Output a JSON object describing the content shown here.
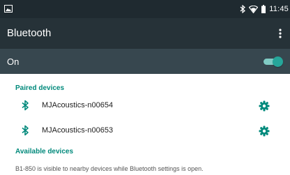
{
  "status_bar": {
    "time": "11:45",
    "left_icon": "image-notification-icon",
    "right_icons": [
      "bluetooth-icon",
      "wifi-icon",
      "battery-icon"
    ]
  },
  "app_bar": {
    "title": "Bluetooth",
    "menu_icon": "overflow-menu-icon"
  },
  "master_switch": {
    "label": "On",
    "state": "on"
  },
  "paired_devices": {
    "header": "Paired devices",
    "items": [
      {
        "name": "MJAcoustics-n00654",
        "icon": "bluetooth-icon",
        "action_icon": "gear-icon"
      },
      {
        "name": "MJAcoustics-n00653",
        "icon": "bluetooth-icon",
        "action_icon": "gear-icon"
      }
    ]
  },
  "available_devices": {
    "header": "Available devices"
  },
  "visibility_note": "B1-850 is visible to nearby devices while Bluetooth settings is open.",
  "colors": {
    "status_bar": "#1f2a30",
    "app_bar": "#263238",
    "master_bar": "#37474f",
    "accent": "#00897b",
    "toggle_thumb": "#26a69a",
    "toggle_track": "#80cbc4"
  }
}
